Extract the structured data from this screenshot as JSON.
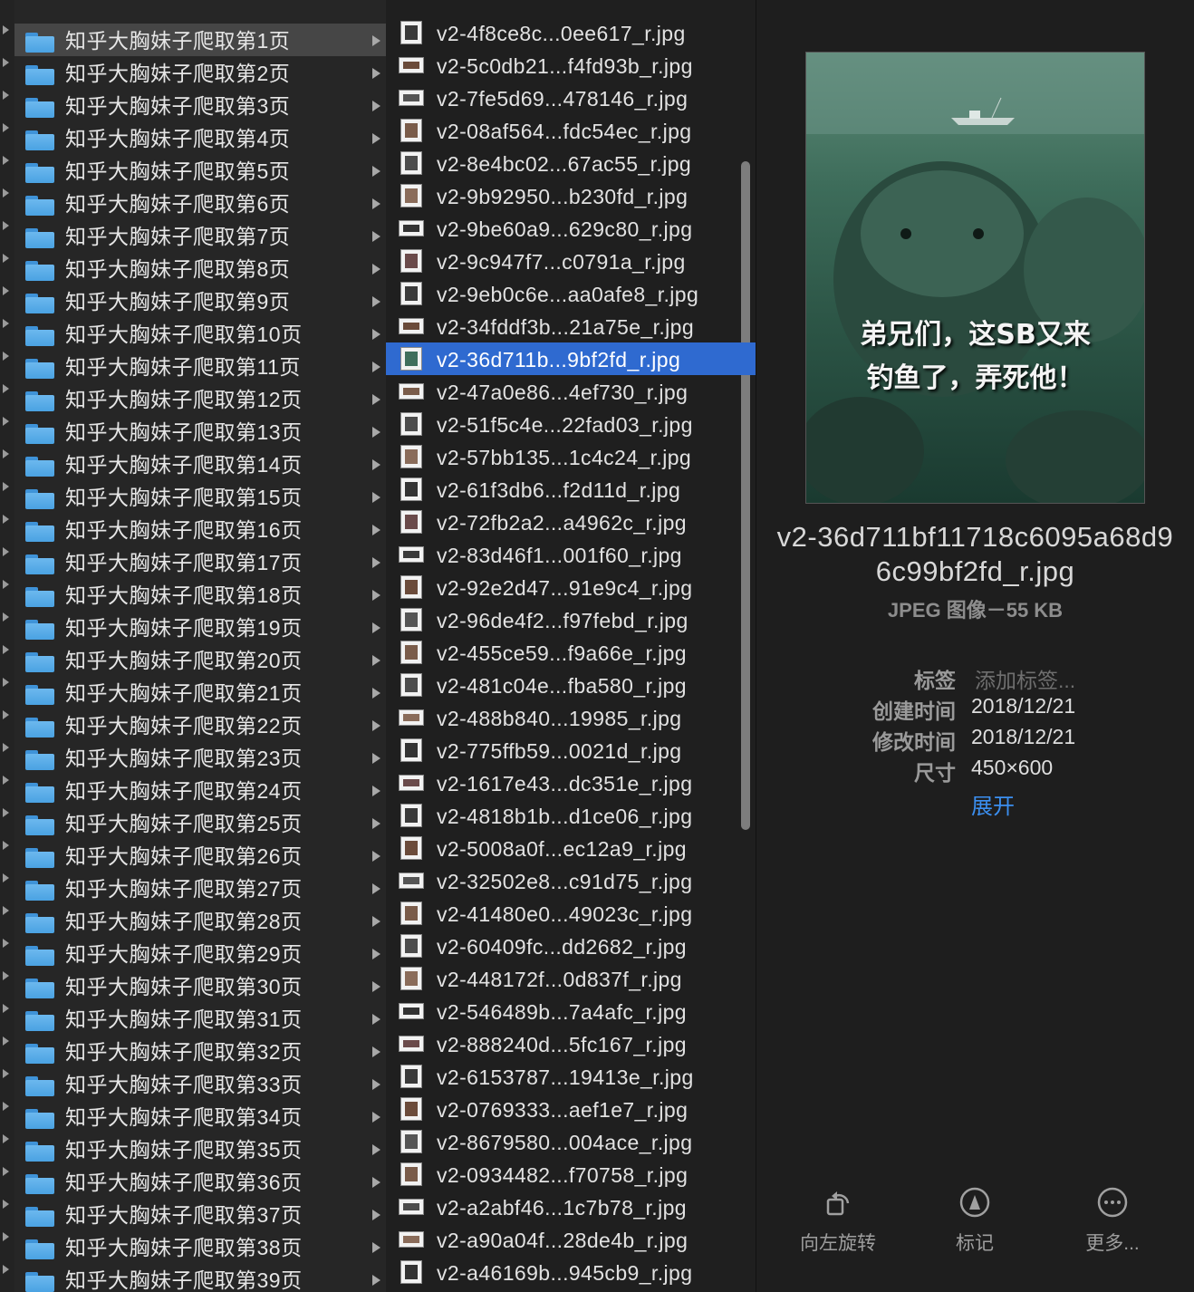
{
  "folders": [
    "知乎大胸妹子爬取第1页",
    "知乎大胸妹子爬取第2页",
    "知乎大胸妹子爬取第3页",
    "知乎大胸妹子爬取第4页",
    "知乎大胸妹子爬取第5页",
    "知乎大胸妹子爬取第6页",
    "知乎大胸妹子爬取第7页",
    "知乎大胸妹子爬取第8页",
    "知乎大胸妹子爬取第9页",
    "知乎大胸妹子爬取第10页",
    "知乎大胸妹子爬取第11页",
    "知乎大胸妹子爬取第12页",
    "知乎大胸妹子爬取第13页",
    "知乎大胸妹子爬取第14页",
    "知乎大胸妹子爬取第15页",
    "知乎大胸妹子爬取第16页",
    "知乎大胸妹子爬取第17页",
    "知乎大胸妹子爬取第18页",
    "知乎大胸妹子爬取第19页",
    "知乎大胸妹子爬取第20页",
    "知乎大胸妹子爬取第21页",
    "知乎大胸妹子爬取第22页",
    "知乎大胸妹子爬取第23页",
    "知乎大胸妹子爬取第24页",
    "知乎大胸妹子爬取第25页",
    "知乎大胸妹子爬取第26页",
    "知乎大胸妹子爬取第27页",
    "知乎大胸妹子爬取第28页",
    "知乎大胸妹子爬取第29页",
    "知乎大胸妹子爬取第30页",
    "知乎大胸妹子爬取第31页",
    "知乎大胸妹子爬取第32页",
    "知乎大胸妹子爬取第33页",
    "知乎大胸妹子爬取第34页",
    "知乎大胸妹子爬取第35页",
    "知乎大胸妹子爬取第36页",
    "知乎大胸妹子爬取第37页",
    "知乎大胸妹子爬取第38页",
    "知乎大胸妹子爬取第39页"
  ],
  "files": [
    "v2-4f8ce8c...0ee617_r.jpg",
    "v2-5c0db21...f4fd93b_r.jpg",
    "v2-7fe5d69...478146_r.jpg",
    "v2-08af564...fdc54ec_r.jpg",
    "v2-8e4bc02...67ac55_r.jpg",
    "v2-9b92950...b230fd_r.jpg",
    "v2-9be60a9...629c80_r.jpg",
    "v2-9c947f7...c0791a_r.jpg",
    "v2-9eb0c6e...aa0afe8_r.jpg",
    "v2-34fddf3b...21a75e_r.jpg",
    "v2-36d711b...9bf2fd_r.jpg",
    "v2-47a0e86...4ef730_r.jpg",
    "v2-51f5c4e...22fad03_r.jpg",
    "v2-57bb135...1c4c24_r.jpg",
    "v2-61f3db6...f2d11d_r.jpg",
    "v2-72fb2a2...a4962c_r.jpg",
    "v2-83d46f1...001f60_r.jpg",
    "v2-92e2d47...91e9c4_r.jpg",
    "v2-96de4f2...f97febd_r.jpg",
    "v2-455ce59...f9a66e_r.jpg",
    "v2-481c04e...fba580_r.jpg",
    "v2-488b840...19985_r.jpg",
    "v2-775ffb59...0021d_r.jpg",
    "v2-1617e43...dc351e_r.jpg",
    "v2-4818b1b...d1ce06_r.jpg",
    "v2-5008a0f...ec12a9_r.jpg",
    "v2-32502e8...c91d75_r.jpg",
    "v2-41480e0...49023c_r.jpg",
    "v2-60409fc...dd2682_r.jpg",
    "v2-448172f...0d837f_r.jpg",
    "v2-546489b...7a4afc_r.jpg",
    "v2-888240d...5fc167_r.jpg",
    "v2-6153787...19413e_r.jpg",
    "v2-0769333...aef1e7_r.jpg",
    "v2-8679580...004ace_r.jpg",
    "v2-0934482...f70758_r.jpg",
    "v2-a2abf46...1c7b78_r.jpg",
    "v2-a90a04f...28de4b_r.jpg",
    "v2-a46169b...945cb9_r.jpg"
  ],
  "selected_file_index": 10,
  "active_folder_index": 0,
  "preview": {
    "caption_line1": "弟兄们，这SB又来",
    "caption_line2": "钓鱼了，弄死他！",
    "filename": "v2-36d711bf11718c6095a68d96c99bf2fd_r.jpg",
    "kind": "JPEG 图像－55 KB"
  },
  "meta": {
    "tags_label": "标签",
    "tags_placeholder": "添加标签...",
    "created_label": "创建时间",
    "created_value": "2018/12/21",
    "modified_label": "修改时间",
    "modified_value": "2018/12/21",
    "size_label": "尺寸",
    "size_value": "450×600",
    "expand_label": "展开"
  },
  "actions": {
    "rotate_label": "向左旋转",
    "markup_label": "标记",
    "more_label": "更多..."
  },
  "colors": {
    "selection": "#2f6ad0",
    "folder": "#5aaee8",
    "link": "#3b8ff0"
  }
}
